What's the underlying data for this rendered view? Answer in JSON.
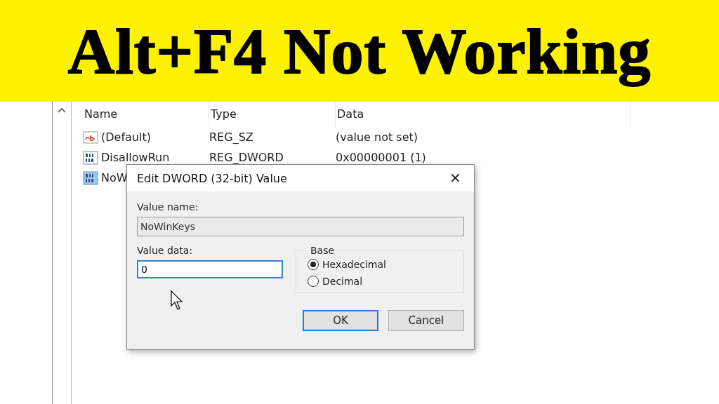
{
  "banner": {
    "title": "Alt+F4 Not Working"
  },
  "registry": {
    "columns": [
      "Name",
      "Type",
      "Data"
    ],
    "rows": [
      {
        "kind": "string",
        "name": "(Default)",
        "type": "REG_SZ",
        "data": "(value not set)",
        "selected": false
      },
      {
        "kind": "dword",
        "name": "DisallowRun",
        "type": "REG_DWORD",
        "data": "0x00000001 (1)",
        "selected": false
      },
      {
        "kind": "dword",
        "name": "NoW",
        "selected": true
      }
    ]
  },
  "dialog": {
    "title": "Edit DWORD (32-bit) Value",
    "close": "✕",
    "value_name_label": "Value name:",
    "value_name": "NoWinKeys",
    "value_data_label": "Value data:",
    "value_data": "0",
    "base_label": "Base",
    "base_options": [
      {
        "label": "Hexadecimal",
        "selected": true
      },
      {
        "label": "Decimal",
        "selected": false
      }
    ],
    "buttons": [
      {
        "label": "OK",
        "kind": "default"
      },
      {
        "label": "Cancel",
        "kind": "normal"
      }
    ]
  }
}
